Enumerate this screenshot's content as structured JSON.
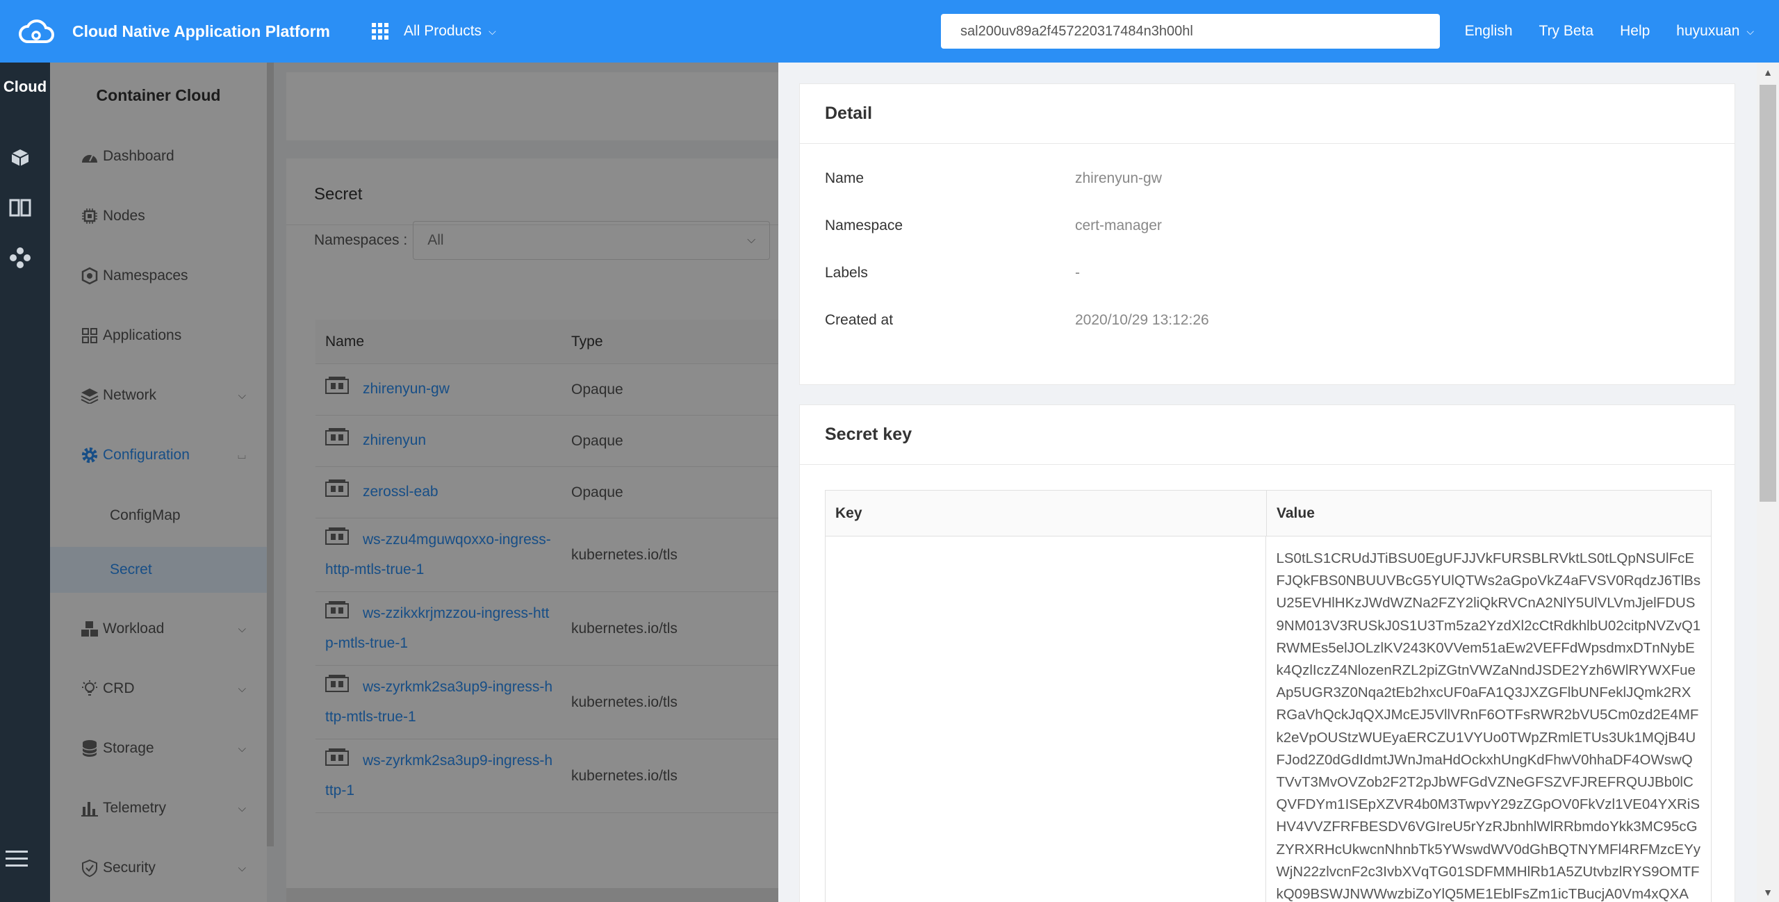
{
  "header": {
    "app_title": "Cloud Native Application Platform",
    "products_label": "All Products",
    "search_value": "sal200uv89a2f457220317484n3h00hl",
    "language": "English",
    "try_beta": "Try Beta",
    "help": "Help",
    "user": "huyuxuan"
  },
  "rail": {
    "title": "Cloud"
  },
  "sidebar": {
    "title": "Container Cloud",
    "items": {
      "dashboard": "Dashboard",
      "nodes": "Nodes",
      "namespaces": "Namespaces",
      "applications": "Applications",
      "network": "Network",
      "configuration": "Configuration",
      "configmap": "ConfigMap",
      "secret": "Secret",
      "workload": "Workload",
      "crd": "CRD",
      "storage": "Storage",
      "telemetry": "Telemetry",
      "security": "Security"
    }
  },
  "main": {
    "title": "Secret",
    "filter_label": "Namespaces :",
    "filter_value": "All",
    "columns": {
      "name": "Name",
      "type": "Type"
    },
    "rows": [
      {
        "name": "zhirenyun-gw",
        "type": "Opaque"
      },
      {
        "name": "zhirenyun",
        "type": "Opaque"
      },
      {
        "name": "zerossl-eab",
        "type": "Opaque"
      },
      {
        "name_line1": "ws-zzu4mguwqoxxo-ingress-",
        "name_line2": "http-mtls-true-1",
        "type": "kubernetes.io/tls"
      },
      {
        "name_line1": "ws-zzikxkrjmzzou-ingress-htt",
        "name_line2": "p-mtls-true-1",
        "type": "kubernetes.io/tls"
      },
      {
        "name_line1": "ws-zyrkmk2sa3up9-ingress-h",
        "name_line2": "ttp-mtls-true-1",
        "type": "kubernetes.io/tls"
      },
      {
        "name_line1": "ws-zyrkmk2sa3up9-ingress-h",
        "name_line2": "ttp-1",
        "type": "kubernetes.io/tls"
      }
    ]
  },
  "drawer": {
    "detail_title": "Detail",
    "fields": {
      "name_label": "Name",
      "name_value": "zhirenyun-gw",
      "namespace_label": "Namespace",
      "namespace_value": "cert-manager",
      "labels_label": "Labels",
      "labels_value": "-",
      "created_label": "Created at",
      "created_value": "2020/10/29 13:12:26"
    },
    "secret_title": "Secret key",
    "key_col": "Key",
    "value_col": "Value",
    "secret_value": "LS0tLS1CRUdJTiBSU0EgUFJJVkFURSBLRVktLS0tLQpNSUlFcEFJQkFBS0NBUUVBcG5YUlQTWs2aGpoVkZ4aFVSV0RqdzJ6TlBsU25EVHlHKzJWdWZNa2FZY2liQkRVCnA2NlY5UlVLVmJjelFDUS9NM013V3RUSkJ0S1U3Tm5za2YzdXl2cCtRdkhlbU02citpNVZvQ1RWMEs5elJOLzlKV243K0VVem51aEw2VEFFdWpsdmxDTnNybEk4QzlIczZ4NlozenRZL2piZGtnVWZaNndJSDE2Yzh6WlRYWXFueAp5UGR3Z0Nqa2tEb2hxcUF0aFA1Q3JXZGFlbUNFeklJQmk2RXRGaVhQckJqQXJMcEJ5VllVRnF6OTFsRWR2bVU5Cm0zd2E4MFk2eVpOUStzWUEyaERCZU1VYUo0TWpZRmlETUs3Uk1MQjB4UFJod2Z0dGdIdmtJWnJmaHdOckxhUngKdFhwV0hhaDF4OWswQTVvT3MvOVZob2F2T2pJbWFGdVZNeGFSZVFJREFRQUJBb0lCQVFDYm1ISEpXZVR4b0M3TwpvY29zZGpOV0FkVzl1VE04YXRiSHV4VVZFRFBESDV6VGIreU5rYzRJbnhlWlRRbmdoYkk3MC95cGZYRXRHcUkwcnNhnbTk5YWswdWV0dGhBQTNYMFl4RFMzcEYyWjN22zlvcnF2c3IvbXVqTG01SDFMMHlRb1A5ZUtvbzlRYS9OMTFkQ09BSWJNWWwzbiZoYlQ5ME1EblFsZm1icTBucjA0Vm4xQXA"
  }
}
